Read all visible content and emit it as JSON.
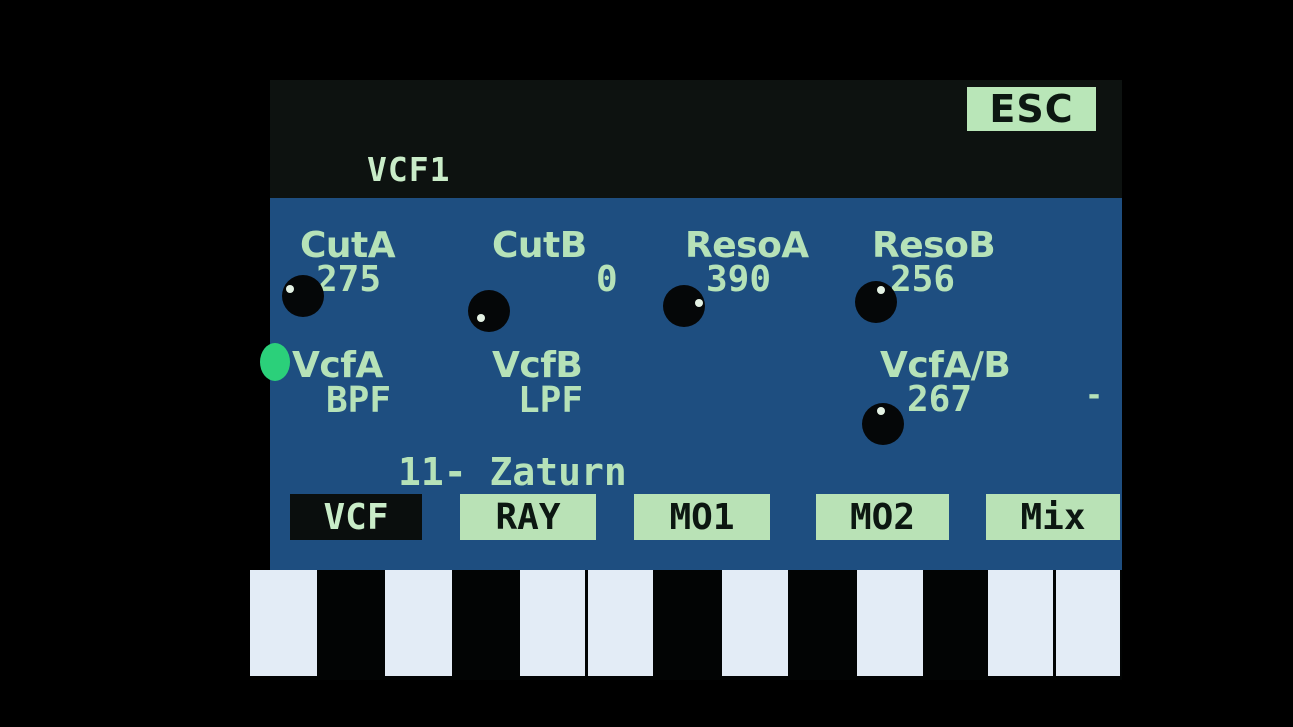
{
  "header": {
    "esc_label": "ESC",
    "title": "VCF1"
  },
  "params_row1": [
    {
      "label": "CutA",
      "value": "275"
    },
    {
      "label": "CutB",
      "value": "0"
    },
    {
      "label": "ResoA",
      "value": "390"
    },
    {
      "label": "ResoB",
      "value": "256"
    }
  ],
  "params_row2": [
    {
      "label": "VcfA",
      "value": "BPF"
    },
    {
      "label": "VcfB",
      "value": "LPF"
    },
    {
      "label": "VcfA/B",
      "value": "267"
    }
  ],
  "row2_minus": "-",
  "preset": "11- Zaturn",
  "tabs": [
    {
      "label": "VCF",
      "active": true
    },
    {
      "label": "RAY",
      "active": false
    },
    {
      "label": "MO1",
      "active": false
    },
    {
      "label": "MO2",
      "active": false
    },
    {
      "label": "Mix",
      "active": false
    }
  ],
  "colors": {
    "panel_bg": "#1e4e80",
    "text": "#b6e2b8",
    "selection_indicator": "#2bd07a",
    "button_bg": "#b9e2b6"
  }
}
